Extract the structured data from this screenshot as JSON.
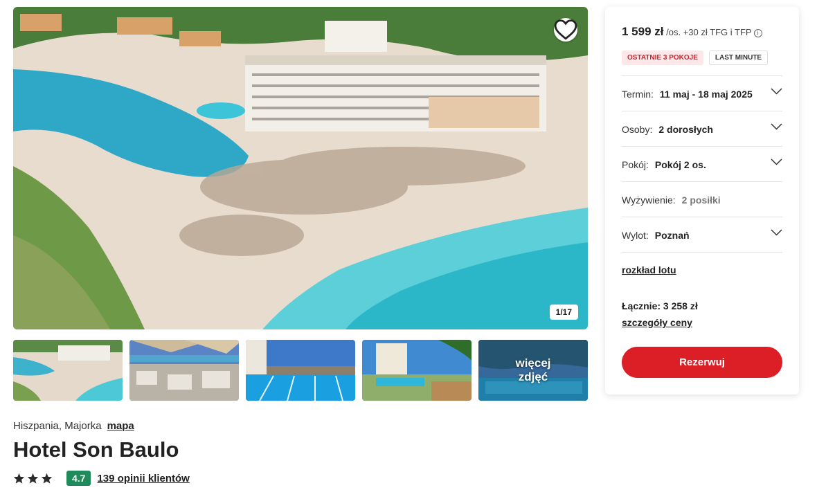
{
  "gallery": {
    "photo_counter": "1/17",
    "favorite_icon": "heart-icon",
    "more_photos_line1": "więcej",
    "more_photos_line2": "zdjęć"
  },
  "hotel": {
    "location": "Hiszpania, Majorka",
    "map_link": "mapa",
    "name": "Hotel Son Baulo",
    "stars": 3,
    "score": "4.7",
    "reviews_link": "139 opinii klientów"
  },
  "booking": {
    "price": "1 599 zł",
    "price_suffix": "/os.",
    "fee_note": "+30 zł TFG i TFP",
    "badges": [
      "OSTATNIE 3 POKOJE",
      "LAST MINUTE"
    ],
    "term_label": "Termin:",
    "term_value": "11 maj - 18 maj 2025",
    "persons_label": "Osoby:",
    "persons_value": "2 dorosłych",
    "room_label": "Pokój:",
    "room_value": "Pokój 2 os.",
    "board_label": "Wyżywienie:",
    "board_value": "2 posiłki",
    "departure_label": "Wylot:",
    "departure_value": "Poznań",
    "flight_schedule_link": "rozkład lotu",
    "total": "Łącznie: 3 258 zł",
    "price_details_link": "szczegóły ceny",
    "book_button": "Rezerwuj"
  },
  "colors": {
    "accent_red": "#dc1f26",
    "score_green": "#1f8a5a",
    "badge_red_bg": "#fde7e8"
  }
}
